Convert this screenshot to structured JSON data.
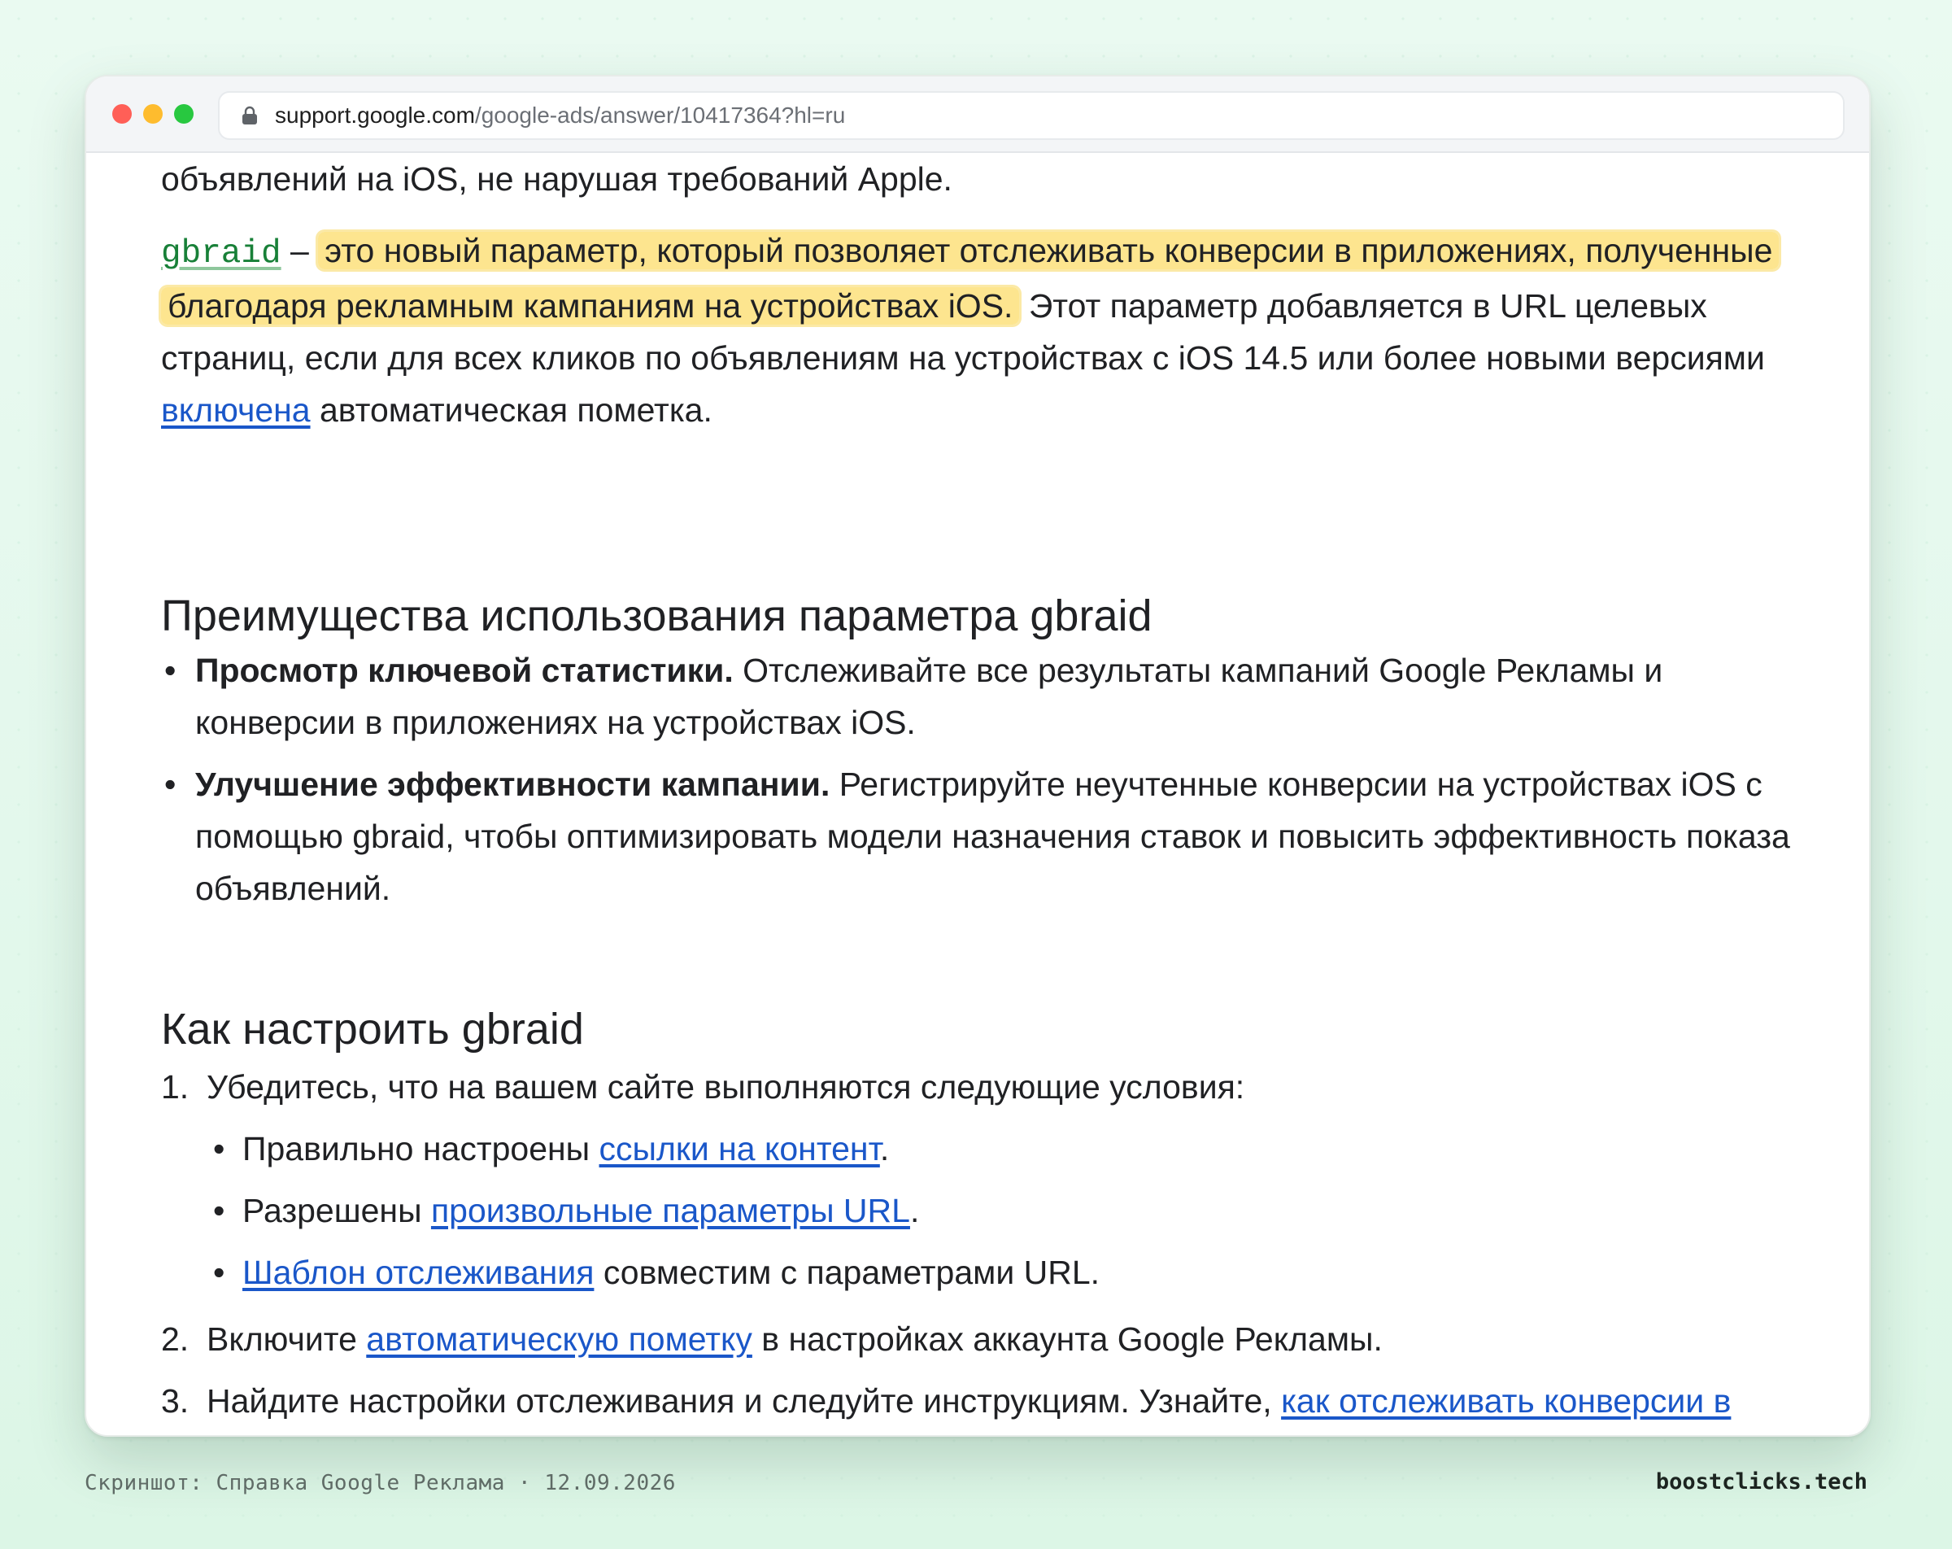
{
  "browser": {
    "url_host": "support.google.com",
    "url_path": "/google-ads/answer/10417364?hl=ru"
  },
  "article": {
    "intro_tail": "объявлений на iOS, не нарушая требований Apple.",
    "gbraid_param": "gbraid",
    "gbraid_dash": " – ",
    "gbraid_highlight": "это новый параметр, который позволяет отслеживать конверсии в приложениях, полученные благодаря рекламным кампаниям на устройствах iOS.",
    "gbraid_rest_before_link": " Этот параметр добавляется в URL целевых страниц, если для всех кликов по объявлениям на устройствах с iOS 14.5 или более новыми версиями ",
    "gbraid_link": "включена",
    "gbraid_rest_after_link": " автоматическая пометка.",
    "benefits_heading": "Преимущества использования параметра gbraid",
    "benefits": [
      {
        "bold": "Просмотр ключевой статистики.",
        "text": " Отслеживайте все результаты кампаний Google Рекламы и конверсии в приложениях на устройствах iOS."
      },
      {
        "bold": "Улучшение эффективности кампании.",
        "text": " Регистрируйте неучтенные конверсии на устройствах iOS с помощью gbraid, чтобы оптимизировать модели назначения ставок и повысить эффективность показа объявлений."
      }
    ],
    "setup_heading": "Как настроить gbraid",
    "steps": [
      {
        "num": "1.",
        "text": "Убедитесь, что на вашем сайте выполняются следующие условия:",
        "sub": [
          {
            "pre": "Правильно настроены ",
            "link": "ссылки на контент",
            "post": "."
          },
          {
            "pre": "Разрешены ",
            "link": "произвольные параметры URL",
            "post": "."
          },
          {
            "pre": "",
            "link": "Шаблон отслеживания",
            "post": " совместим с параметрами URL."
          }
        ]
      },
      {
        "num": "2.",
        "pre": "Включите ",
        "link": "автоматическую пометку",
        "post": " в настройках аккаунта Google Рекламы."
      },
      {
        "num": "3.",
        "pre": "Найдите настройки отслеживания и следуйте инструкциям. Узнайте, ",
        "link": "как отслеживать конверсии в приложении с помощью партнера по атрибуции",
        "post": "."
      }
    ]
  },
  "footer": {
    "caption": "Скриншот: Справка Google Реклама · 12.09.2026",
    "brand": "boostclicks.tech"
  },
  "colors": {
    "link": "#1a57c9",
    "highlight": "#fde58f",
    "code": "#188038",
    "background": "#e3f8ec"
  },
  "icons": {
    "lock": "lock-icon"
  }
}
